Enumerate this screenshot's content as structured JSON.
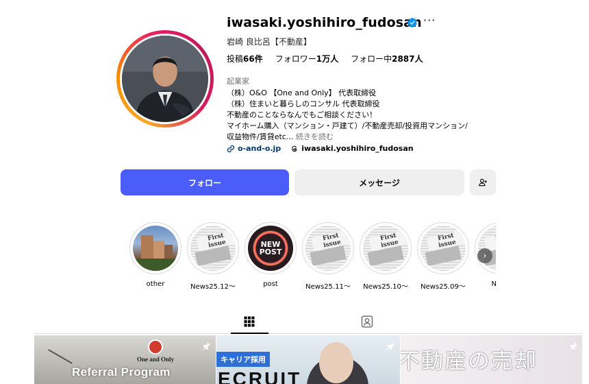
{
  "profile": {
    "username": "iwasaki.yoshihiro_fudosan",
    "full_name": "岩崎 良比呂【不動産】",
    "stats": {
      "posts_label": "投稿",
      "posts_value": "66件",
      "followers_label": "フォロワー",
      "followers_value": "1万人",
      "following_label": "フォロー中",
      "following_value": "2887人"
    },
    "category": "起業家",
    "bio_lines": [
      "（株）O&O 【One and Only】 代表取締役",
      "（株）住まいと暮らしのコンサル 代表取締役",
      "不動産のことならなんでもご相談ください！",
      "マイホーム購入（マンション・戸建て）/不動産売却/投資用マンション/",
      "収益物件/賃貸etc..."
    ],
    "bio_more": " 続きを読む",
    "link_url": "o-and-o.jp",
    "threads_handle": "iwasaki.yoshihiro_fudosan"
  },
  "actions": {
    "follow_label": "フォロー",
    "message_label": "メッセージ"
  },
  "highlights": [
    {
      "label": "other"
    },
    {
      "label": "News25.12～"
    },
    {
      "label": "post",
      "badge_line1": "NEW",
      "badge_line2": "POST"
    },
    {
      "label": "News25.11～"
    },
    {
      "label": "News25.10～"
    },
    {
      "label": "News25.09～"
    },
    {
      "label": "News"
    }
  ],
  "highlight_paper_text": "First issue",
  "posts": [
    {
      "logo_text": "One and Only",
      "title": "Referral Program"
    },
    {
      "tag": "キャリア採用",
      "big_text": "ECRUIT"
    },
    {
      "text": "不動産の売却"
    }
  ],
  "colors": {
    "follow_button": "#4a5df9",
    "link": "#00376b",
    "verified": "#0095f6"
  }
}
